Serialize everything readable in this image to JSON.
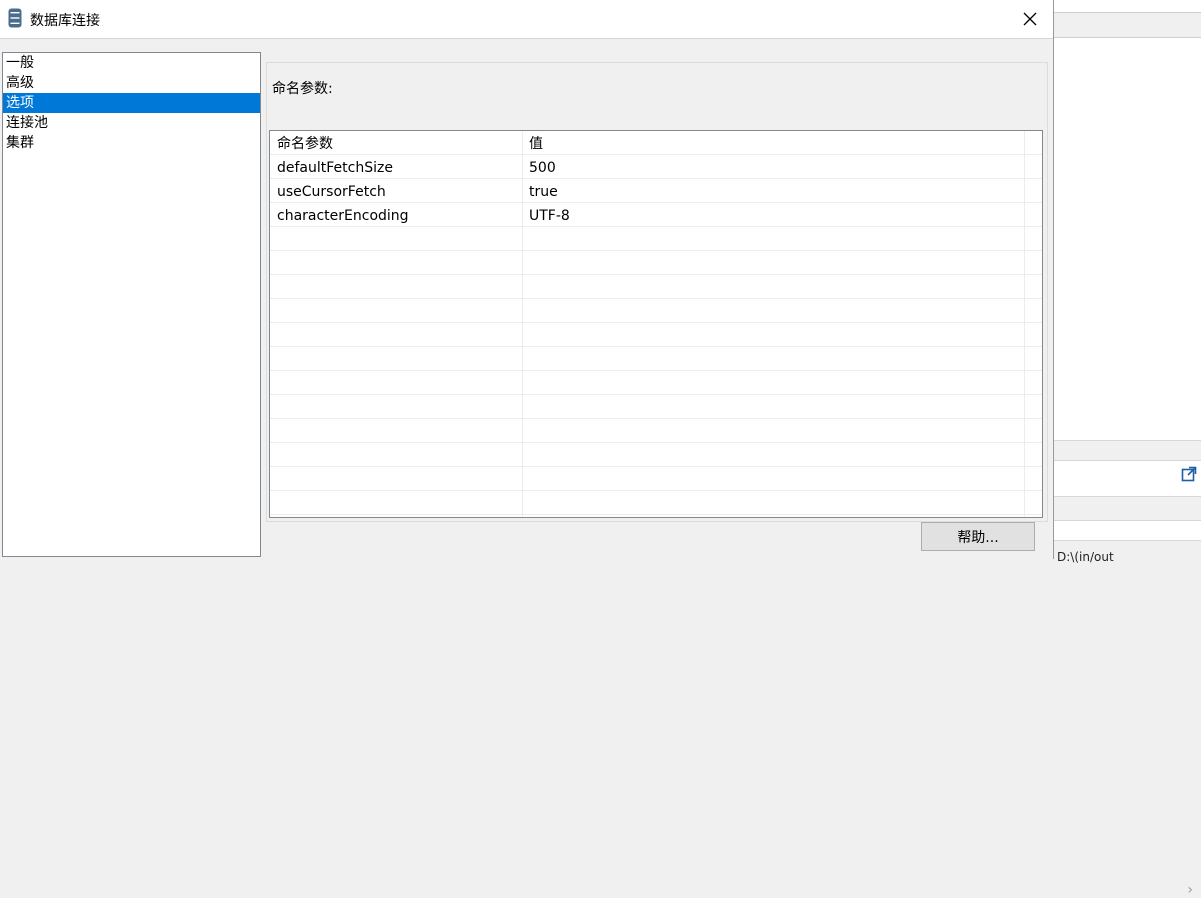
{
  "dialog": {
    "title": "数据库连接",
    "close_label": "×"
  },
  "nav": {
    "items": [
      {
        "label": "一般",
        "selected": false
      },
      {
        "label": "高级",
        "selected": false
      },
      {
        "label": "选项",
        "selected": true
      },
      {
        "label": "连接池",
        "selected": false
      },
      {
        "label": "集群",
        "selected": false
      }
    ]
  },
  "options": {
    "section_label": "命名参数:",
    "table": {
      "headers": [
        "命名参数",
        "值"
      ],
      "rows": [
        [
          "defaultFetchSize",
          "500"
        ],
        [
          "useCursorFetch",
          "true"
        ],
        [
          "characterEncoding",
          "UTF-8"
        ]
      ]
    }
  },
  "footer": {
    "help_label": "帮助..."
  },
  "background_app": {
    "path_text": "D:\\(in/out"
  },
  "colors": {
    "selection": "#0078d7",
    "title_icon": "#4a6d8c"
  }
}
